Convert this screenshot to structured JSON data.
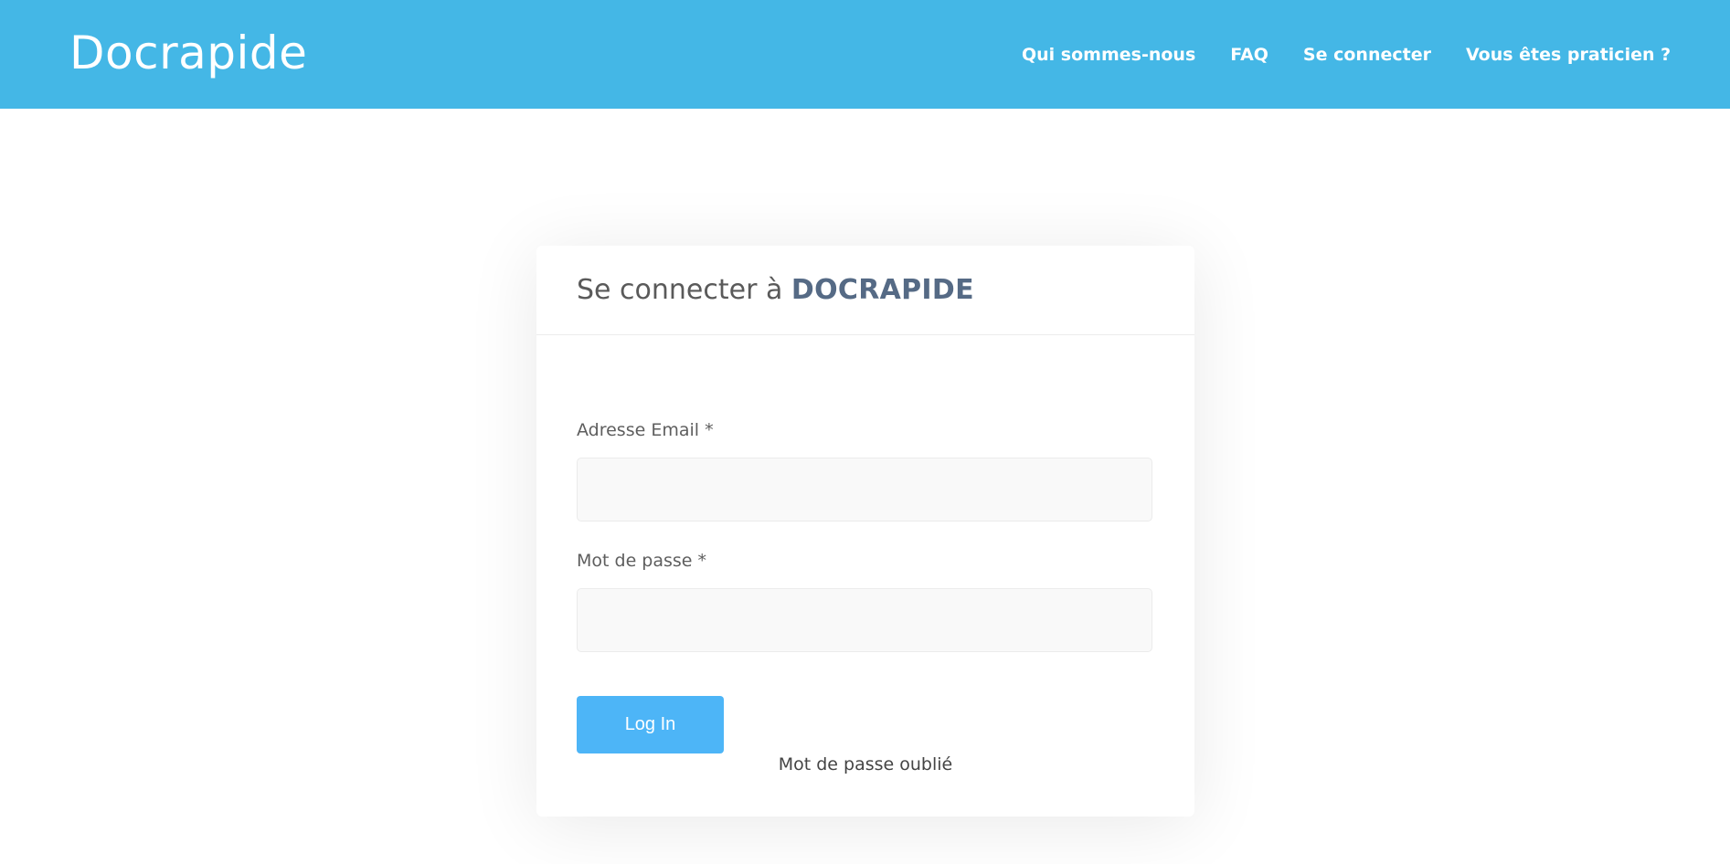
{
  "header": {
    "logo": "Docrapide",
    "nav": [
      {
        "label": "Qui sommes-nous"
      },
      {
        "label": "FAQ"
      },
      {
        "label": "Se connecter"
      },
      {
        "label": "Vous êtes praticien ?"
      }
    ]
  },
  "login": {
    "title_prefix": "Se connecter à ",
    "title_brand": "DOCRAPIDE",
    "email_label": "Adresse Email *",
    "email_value": "",
    "password_label": "Mot de passe *",
    "password_value": "",
    "submit_label": "Log In",
    "forgot_label": "Mot de passe oublié"
  },
  "colors": {
    "header_bg": "#44b7e6",
    "button_bg": "#4db5f7",
    "brand_text": "#556a85"
  }
}
